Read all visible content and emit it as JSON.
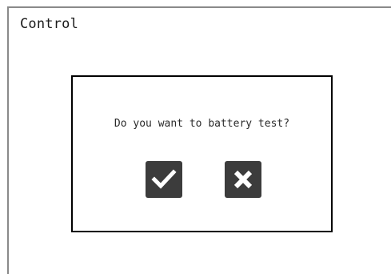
{
  "screen": {
    "title": "Control"
  },
  "dialog": {
    "message": "Do you want to battery test?",
    "confirm_icon": "checkmark-icon",
    "cancel_icon": "close-x-icon"
  },
  "colors": {
    "background": "#ffffff",
    "frame": "#8a8a8a",
    "dialog_border": "#000000",
    "button_fill": "#3c3c3c",
    "icon_glyph": "#ffffff"
  }
}
